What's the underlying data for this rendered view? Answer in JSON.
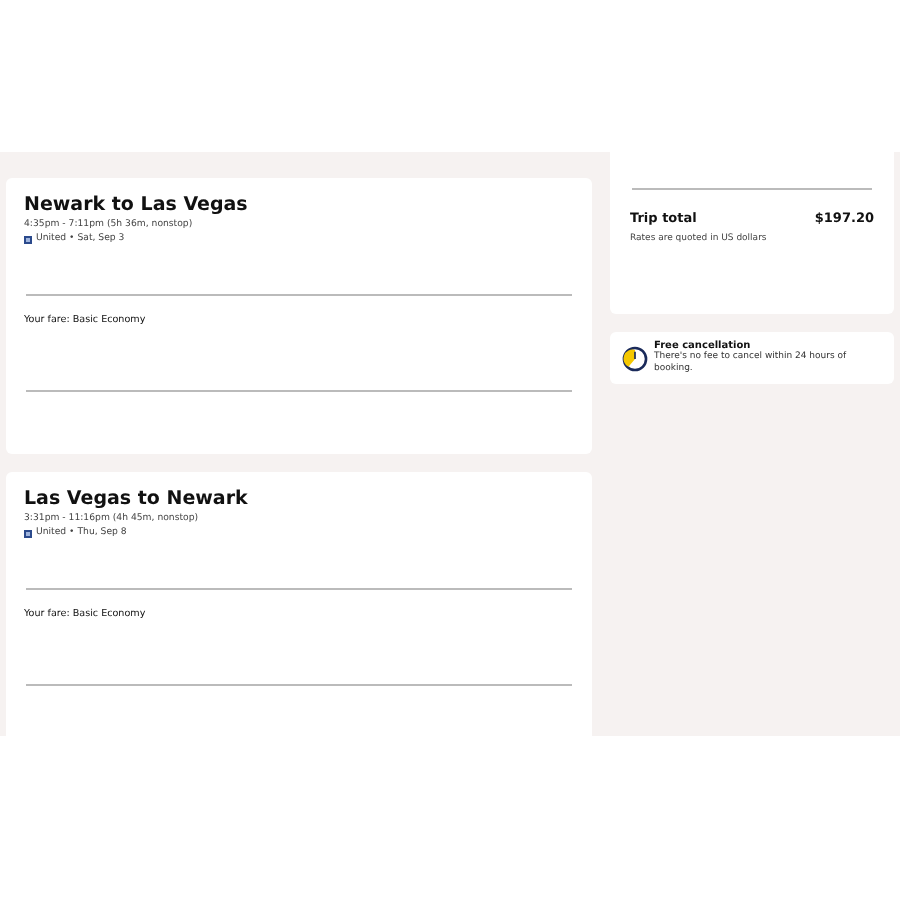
{
  "flights": [
    {
      "title": "Newark to Las Vegas",
      "times": "4:35pm - 7:11pm (5h 36m, nonstop)",
      "airline_date": "United • Sat, Sep 3",
      "fare": "Your fare: Basic Economy"
    },
    {
      "title": "Las Vegas to Newark",
      "times": "3:31pm - 11:16pm (4h 45m, nonstop)",
      "airline_date": "United • Thu, Sep 8",
      "fare": "Your fare: Basic Economy"
    }
  ],
  "summary": {
    "total_label": "Trip total",
    "total_value": "$197.20",
    "note": "Rates are quoted in US dollars"
  },
  "cancellation": {
    "title": "Free cancellation",
    "text": "There's no fee to cancel within 24 hours of booking."
  }
}
